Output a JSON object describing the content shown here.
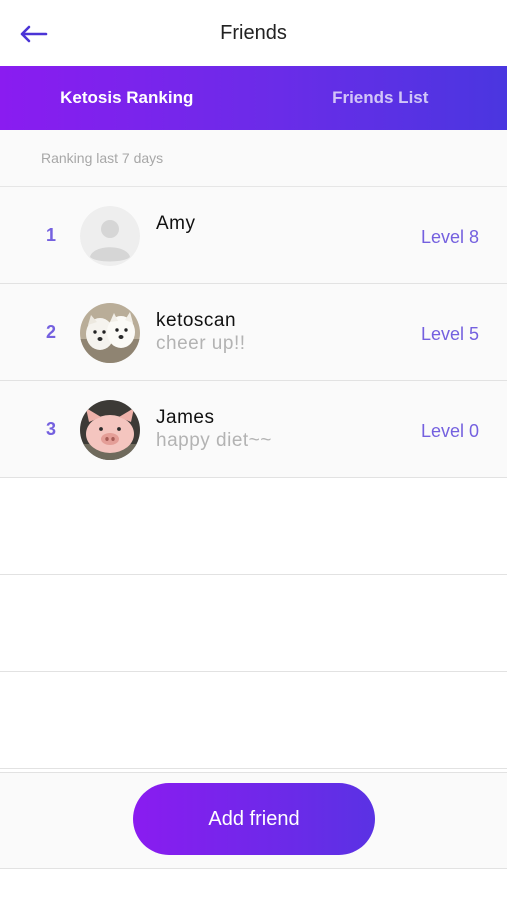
{
  "header": {
    "title": "Friends",
    "back_icon": "arrow-left-icon"
  },
  "tabs": [
    {
      "label": "Ketosis Ranking",
      "active": true
    },
    {
      "label": "Friends List",
      "active": false
    }
  ],
  "subhead": "Ranking last 7 days",
  "friends": [
    {
      "rank": "1",
      "name": "Amy",
      "status": "",
      "level": "Level 8",
      "avatar": "default-avatar-icon"
    },
    {
      "rank": "2",
      "name": "ketoscan",
      "status": "cheer up!!",
      "level": "Level 5",
      "avatar": "dogs-photo-icon"
    },
    {
      "rank": "3",
      "name": "James",
      "status": "happy diet~~",
      "level": "Level 0",
      "avatar": "pig-photo-icon"
    }
  ],
  "add_button_label": "Add friend",
  "colors": {
    "accent": "#7460df",
    "gradient_start": "#8a1cf0",
    "gradient_end": "#4a36e0"
  }
}
